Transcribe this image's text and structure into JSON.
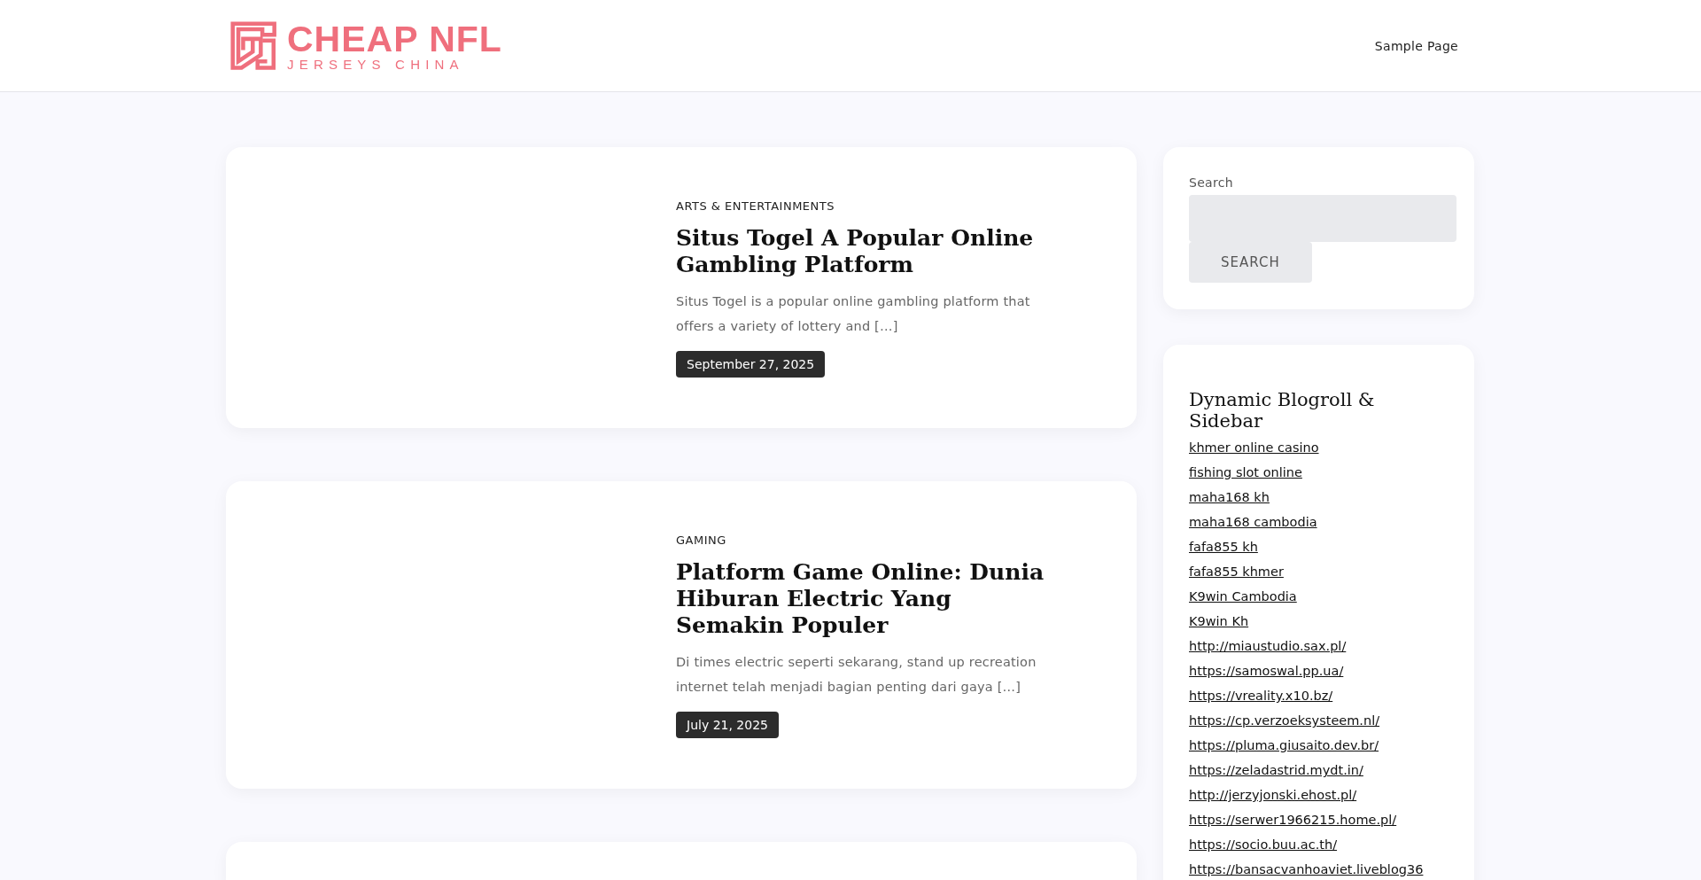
{
  "header": {
    "logo": {
      "title": "CHEAP NFL",
      "subtitle": "JERSEYS CHINA"
    },
    "nav": [
      {
        "label": "Sample Page"
      }
    ]
  },
  "posts": [
    {
      "kind": "post",
      "category": "ARTS & ENTERTAINMENTS",
      "title": "Situs Togel A Popular Online Gambling Platform",
      "excerpt": "Situs Togel is a popular online gambling platform that offers a variety of lottery and […]",
      "date": "September 27, 2025"
    },
    {
      "kind": "post",
      "category": "GAMING",
      "title": "Platform Game Online: Dunia Hiburan Electric Yang Semakin Populer",
      "excerpt": "Di times electric seperti sekarang, stand up recreation internet telah menjadi bagian penting dari gaya […]",
      "date": "July 21, 2025"
    },
    {
      "kind": "cut-off"
    }
  ],
  "sidebar": {
    "search": {
      "label": "Search",
      "button": "SEARCH"
    },
    "blogroll": {
      "title": "Dynamic Blogroll & Sidebar",
      "links": [
        "khmer online casino",
        "fishing slot online",
        "maha168 kh",
        "maha168 cambodia",
        "fafa855 kh",
        "fafa855 khmer",
        "K9win Cambodia",
        "K9win Kh",
        "http://miaustudio.sax.pl/",
        "https://samoswal.pp.ua/",
        "https://vreality.x10.bz/",
        "https://cp.verzoeksysteem.nl/",
        "https://pluma.giusaito.dev.br/",
        "https://zeladastrid.mydt.in/",
        "http://jerzyjonski.ehost.pl/",
        "https://serwer1966215.home.pl/",
        "https://socio.buu.ac.th/",
        "https://bansacvanhoaviet.liveblog36"
      ]
    }
  }
}
